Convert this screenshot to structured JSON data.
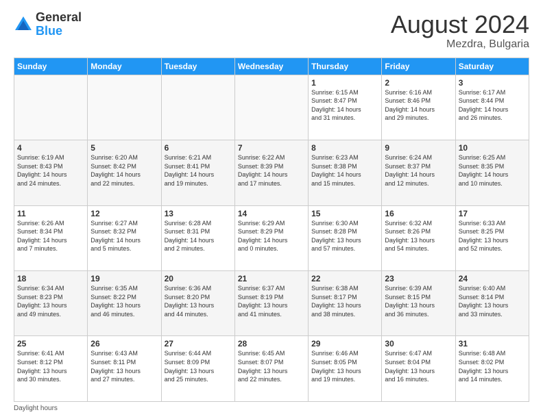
{
  "header": {
    "logo_general": "General",
    "logo_blue": "Blue",
    "month_year": "August 2024",
    "location": "Mezdra, Bulgaria"
  },
  "days_of_week": [
    "Sunday",
    "Monday",
    "Tuesday",
    "Wednesday",
    "Thursday",
    "Friday",
    "Saturday"
  ],
  "weeks": [
    [
      {
        "day": "",
        "info": ""
      },
      {
        "day": "",
        "info": ""
      },
      {
        "day": "",
        "info": ""
      },
      {
        "day": "",
        "info": ""
      },
      {
        "day": "1",
        "info": "Sunrise: 6:15 AM\nSunset: 8:47 PM\nDaylight: 14 hours\nand 31 minutes."
      },
      {
        "day": "2",
        "info": "Sunrise: 6:16 AM\nSunset: 8:46 PM\nDaylight: 14 hours\nand 29 minutes."
      },
      {
        "day": "3",
        "info": "Sunrise: 6:17 AM\nSunset: 8:44 PM\nDaylight: 14 hours\nand 26 minutes."
      }
    ],
    [
      {
        "day": "4",
        "info": "Sunrise: 6:19 AM\nSunset: 8:43 PM\nDaylight: 14 hours\nand 24 minutes."
      },
      {
        "day": "5",
        "info": "Sunrise: 6:20 AM\nSunset: 8:42 PM\nDaylight: 14 hours\nand 22 minutes."
      },
      {
        "day": "6",
        "info": "Sunrise: 6:21 AM\nSunset: 8:41 PM\nDaylight: 14 hours\nand 19 minutes."
      },
      {
        "day": "7",
        "info": "Sunrise: 6:22 AM\nSunset: 8:39 PM\nDaylight: 14 hours\nand 17 minutes."
      },
      {
        "day": "8",
        "info": "Sunrise: 6:23 AM\nSunset: 8:38 PM\nDaylight: 14 hours\nand 15 minutes."
      },
      {
        "day": "9",
        "info": "Sunrise: 6:24 AM\nSunset: 8:37 PM\nDaylight: 14 hours\nand 12 minutes."
      },
      {
        "day": "10",
        "info": "Sunrise: 6:25 AM\nSunset: 8:35 PM\nDaylight: 14 hours\nand 10 minutes."
      }
    ],
    [
      {
        "day": "11",
        "info": "Sunrise: 6:26 AM\nSunset: 8:34 PM\nDaylight: 14 hours\nand 7 minutes."
      },
      {
        "day": "12",
        "info": "Sunrise: 6:27 AM\nSunset: 8:32 PM\nDaylight: 14 hours\nand 5 minutes."
      },
      {
        "day": "13",
        "info": "Sunrise: 6:28 AM\nSunset: 8:31 PM\nDaylight: 14 hours\nand 2 minutes."
      },
      {
        "day": "14",
        "info": "Sunrise: 6:29 AM\nSunset: 8:29 PM\nDaylight: 14 hours\nand 0 minutes."
      },
      {
        "day": "15",
        "info": "Sunrise: 6:30 AM\nSunset: 8:28 PM\nDaylight: 13 hours\nand 57 minutes."
      },
      {
        "day": "16",
        "info": "Sunrise: 6:32 AM\nSunset: 8:26 PM\nDaylight: 13 hours\nand 54 minutes."
      },
      {
        "day": "17",
        "info": "Sunrise: 6:33 AM\nSunset: 8:25 PM\nDaylight: 13 hours\nand 52 minutes."
      }
    ],
    [
      {
        "day": "18",
        "info": "Sunrise: 6:34 AM\nSunset: 8:23 PM\nDaylight: 13 hours\nand 49 minutes."
      },
      {
        "day": "19",
        "info": "Sunrise: 6:35 AM\nSunset: 8:22 PM\nDaylight: 13 hours\nand 46 minutes."
      },
      {
        "day": "20",
        "info": "Sunrise: 6:36 AM\nSunset: 8:20 PM\nDaylight: 13 hours\nand 44 minutes."
      },
      {
        "day": "21",
        "info": "Sunrise: 6:37 AM\nSunset: 8:19 PM\nDaylight: 13 hours\nand 41 minutes."
      },
      {
        "day": "22",
        "info": "Sunrise: 6:38 AM\nSunset: 8:17 PM\nDaylight: 13 hours\nand 38 minutes."
      },
      {
        "day": "23",
        "info": "Sunrise: 6:39 AM\nSunset: 8:15 PM\nDaylight: 13 hours\nand 36 minutes."
      },
      {
        "day": "24",
        "info": "Sunrise: 6:40 AM\nSunset: 8:14 PM\nDaylight: 13 hours\nand 33 minutes."
      }
    ],
    [
      {
        "day": "25",
        "info": "Sunrise: 6:41 AM\nSunset: 8:12 PM\nDaylight: 13 hours\nand 30 minutes."
      },
      {
        "day": "26",
        "info": "Sunrise: 6:43 AM\nSunset: 8:11 PM\nDaylight: 13 hours\nand 27 minutes."
      },
      {
        "day": "27",
        "info": "Sunrise: 6:44 AM\nSunset: 8:09 PM\nDaylight: 13 hours\nand 25 minutes."
      },
      {
        "day": "28",
        "info": "Sunrise: 6:45 AM\nSunset: 8:07 PM\nDaylight: 13 hours\nand 22 minutes."
      },
      {
        "day": "29",
        "info": "Sunrise: 6:46 AM\nSunset: 8:05 PM\nDaylight: 13 hours\nand 19 minutes."
      },
      {
        "day": "30",
        "info": "Sunrise: 6:47 AM\nSunset: 8:04 PM\nDaylight: 13 hours\nand 16 minutes."
      },
      {
        "day": "31",
        "info": "Sunrise: 6:48 AM\nSunset: 8:02 PM\nDaylight: 13 hours\nand 14 minutes."
      }
    ]
  ],
  "footer": {
    "daylight_label": "Daylight hours"
  }
}
